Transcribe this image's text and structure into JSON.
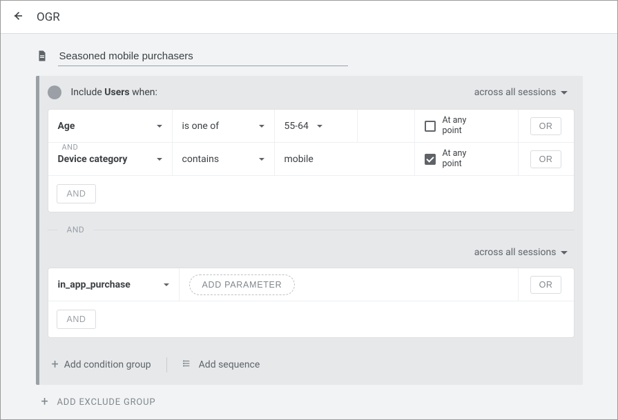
{
  "header": {
    "title": "OGR"
  },
  "segment": {
    "title": "Seasoned mobile purchasers"
  },
  "include": {
    "prefix": "Include",
    "subject": "Users",
    "suffix": "when:",
    "scope": "across all sessions"
  },
  "conditions": [
    {
      "dimension": "Age",
      "operator": "is one of",
      "value": "55-64",
      "at_any_point_label": "At any point",
      "at_any_point_checked": false,
      "or_label": "OR"
    },
    {
      "dimension": "Device category",
      "operator": "contains",
      "value": "mobile",
      "at_any_point_label": "At any point",
      "at_any_point_checked": true,
      "or_label": "OR"
    }
  ],
  "and_inline_label": "AND",
  "and_button_label": "AND",
  "group_separator_label": "AND",
  "group2": {
    "scope": "across all sessions",
    "event": "in_app_purchase",
    "add_parameter_label": "ADD PARAMETER",
    "or_label": "OR",
    "and_button_label": "AND"
  },
  "footer": {
    "add_condition_group": "Add condition group",
    "add_sequence": "Add sequence"
  },
  "exclude_label": "ADD EXCLUDE GROUP"
}
